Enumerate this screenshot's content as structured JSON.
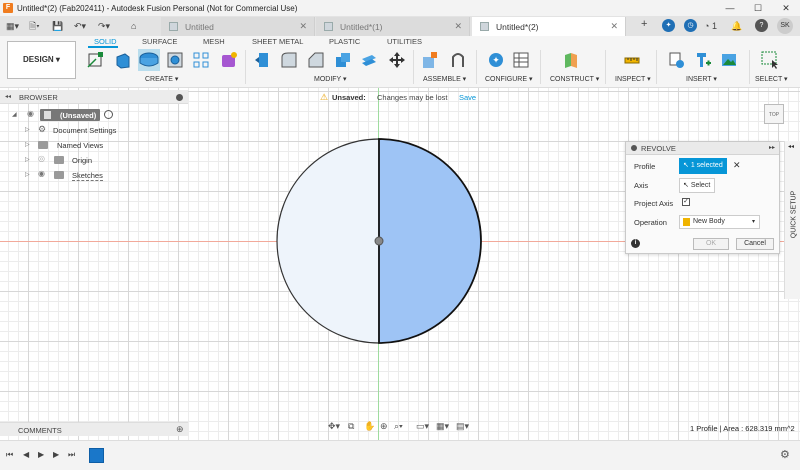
{
  "window": {
    "title": "Untitled*(2) (Fab202411) - Autodesk Fusion Personal (Not for Commercial Use)",
    "controls": {
      "minimize": "—",
      "maximize": "☐",
      "close": "✕"
    }
  },
  "tabs": [
    {
      "label": "Untitled",
      "active": false,
      "close": "✕"
    },
    {
      "label": "Untitled*(1)",
      "active": false,
      "close": "✕"
    },
    {
      "label": "Untitled*(2)",
      "active": true,
      "close": "✕"
    }
  ],
  "tabbar": {
    "new_tab": "+",
    "job_count": "1",
    "user_initials": "SK",
    "help": "?"
  },
  "toolbar": {
    "workspace": "DESIGN ▾",
    "workspace_tabs": [
      "SOLID",
      "SURFACE",
      "MESH",
      "SHEET METAL",
      "PLASTIC",
      "UTILITIES"
    ],
    "active_tab": "SOLID",
    "groups": [
      "CREATE ▾",
      "MODIFY ▾",
      "ASSEMBLE ▾",
      "CONFIGURE ▾",
      "CONSTRUCT ▾",
      "INSPECT ▾",
      "INSERT ▾",
      "SELECT ▾"
    ]
  },
  "browser": {
    "header": "BROWSER",
    "collapse": "◂◂",
    "items": [
      {
        "label": "(Unsaved)"
      },
      {
        "label": "Document Settings"
      },
      {
        "label": "Named Views"
      },
      {
        "label": "Origin"
      },
      {
        "label": "Sketches"
      }
    ]
  },
  "warning": {
    "label": "Unsaved:",
    "message": "Changes may be lost",
    "action": "Save"
  },
  "viewcube": {
    "face": "TOP"
  },
  "revolve_panel": {
    "title": "REVOLVE",
    "profile_label": "Profile",
    "profile_value": "1 selected",
    "axis_label": "Axis",
    "axis_value": "Select",
    "project_axis_label": "Project Axis",
    "project_axis_checked": true,
    "operation_label": "Operation",
    "operation_value": "New Body",
    "ok": "OK",
    "cancel": "Cancel",
    "info": "i"
  },
  "quick_setup": "QUICK SETUP",
  "comments": {
    "label": "COMMENTS"
  },
  "status": "1 Profile | Area : 628.319 mm^2",
  "colors": {
    "accent": "#0696d7",
    "selected_fill": "#9ec4f5",
    "profile_fill": "#eef4fb"
  }
}
